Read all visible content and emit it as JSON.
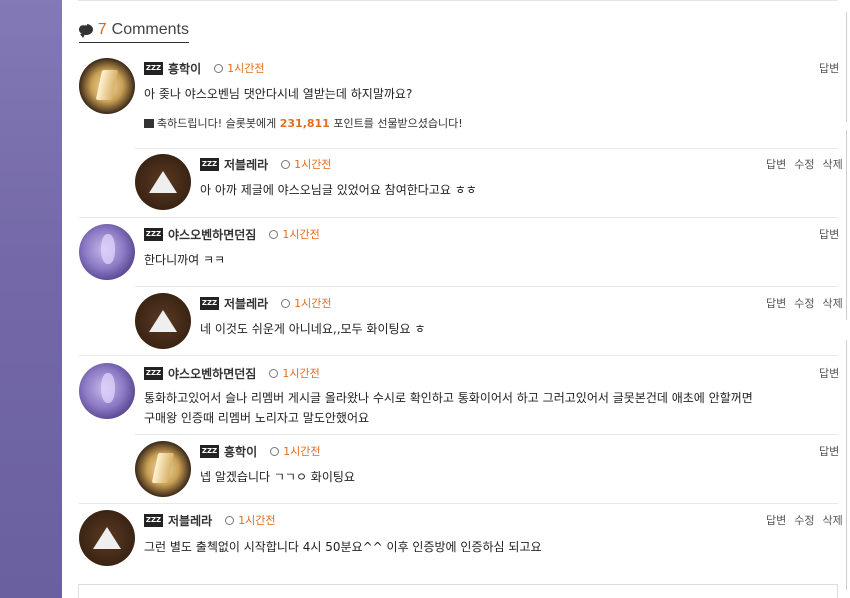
{
  "header": {
    "count": "7",
    "label": "Comments"
  },
  "labels": {
    "reply": "답변",
    "edit": "수정",
    "delete": "삭제",
    "level_badge": "ZZZ"
  },
  "comments": [
    {
      "nick": "흥학이",
      "time": "1시간전",
      "text": "아 좆나 야스오벤님 댓안다시네 열받는데 하지말까요?",
      "notice_pre": "축하드립니다! 슬롯봇에게",
      "notice_points": "231,811",
      "notice_post": "포인트를 선물받으셨습니다!"
    },
    {
      "nick": "저블레라",
      "time": "1시간전",
      "text": "아 아까 제글에 야스오님글 있었어요 참여한다고요 ㅎㅎ"
    },
    {
      "nick": "야스오벤하면던짐",
      "time": "1시간전",
      "text": "한다니까여 ㅋㅋ"
    },
    {
      "nick": "저블레라",
      "time": "1시간전",
      "text": "네 이것도 쉬운게 아니네요,,모두 화이팅요 ㅎ"
    },
    {
      "nick": "야스오벤하면던짐",
      "time": "1시간전",
      "text": "통화하고있어서 슬나 리멤버 게시글 올라왔나 수시로 확인하고 통화이어서 하고 그러고있어서 글못본건데 애초에 안할꺼면",
      "text2": "구매왕 인증때 리멤버 노리자고 말도안했어요"
    },
    {
      "nick": "흥학이",
      "time": "1시간전",
      "text": "넵 알겠습니다 ㄱㄱㅇ 화이팅요"
    },
    {
      "nick": "저블레라",
      "time": "1시간전",
      "text": "그런 별도 출첵없이 시작합니다 4시 50분요^^  이후 인증방에 인증하심 되고요"
    }
  ]
}
